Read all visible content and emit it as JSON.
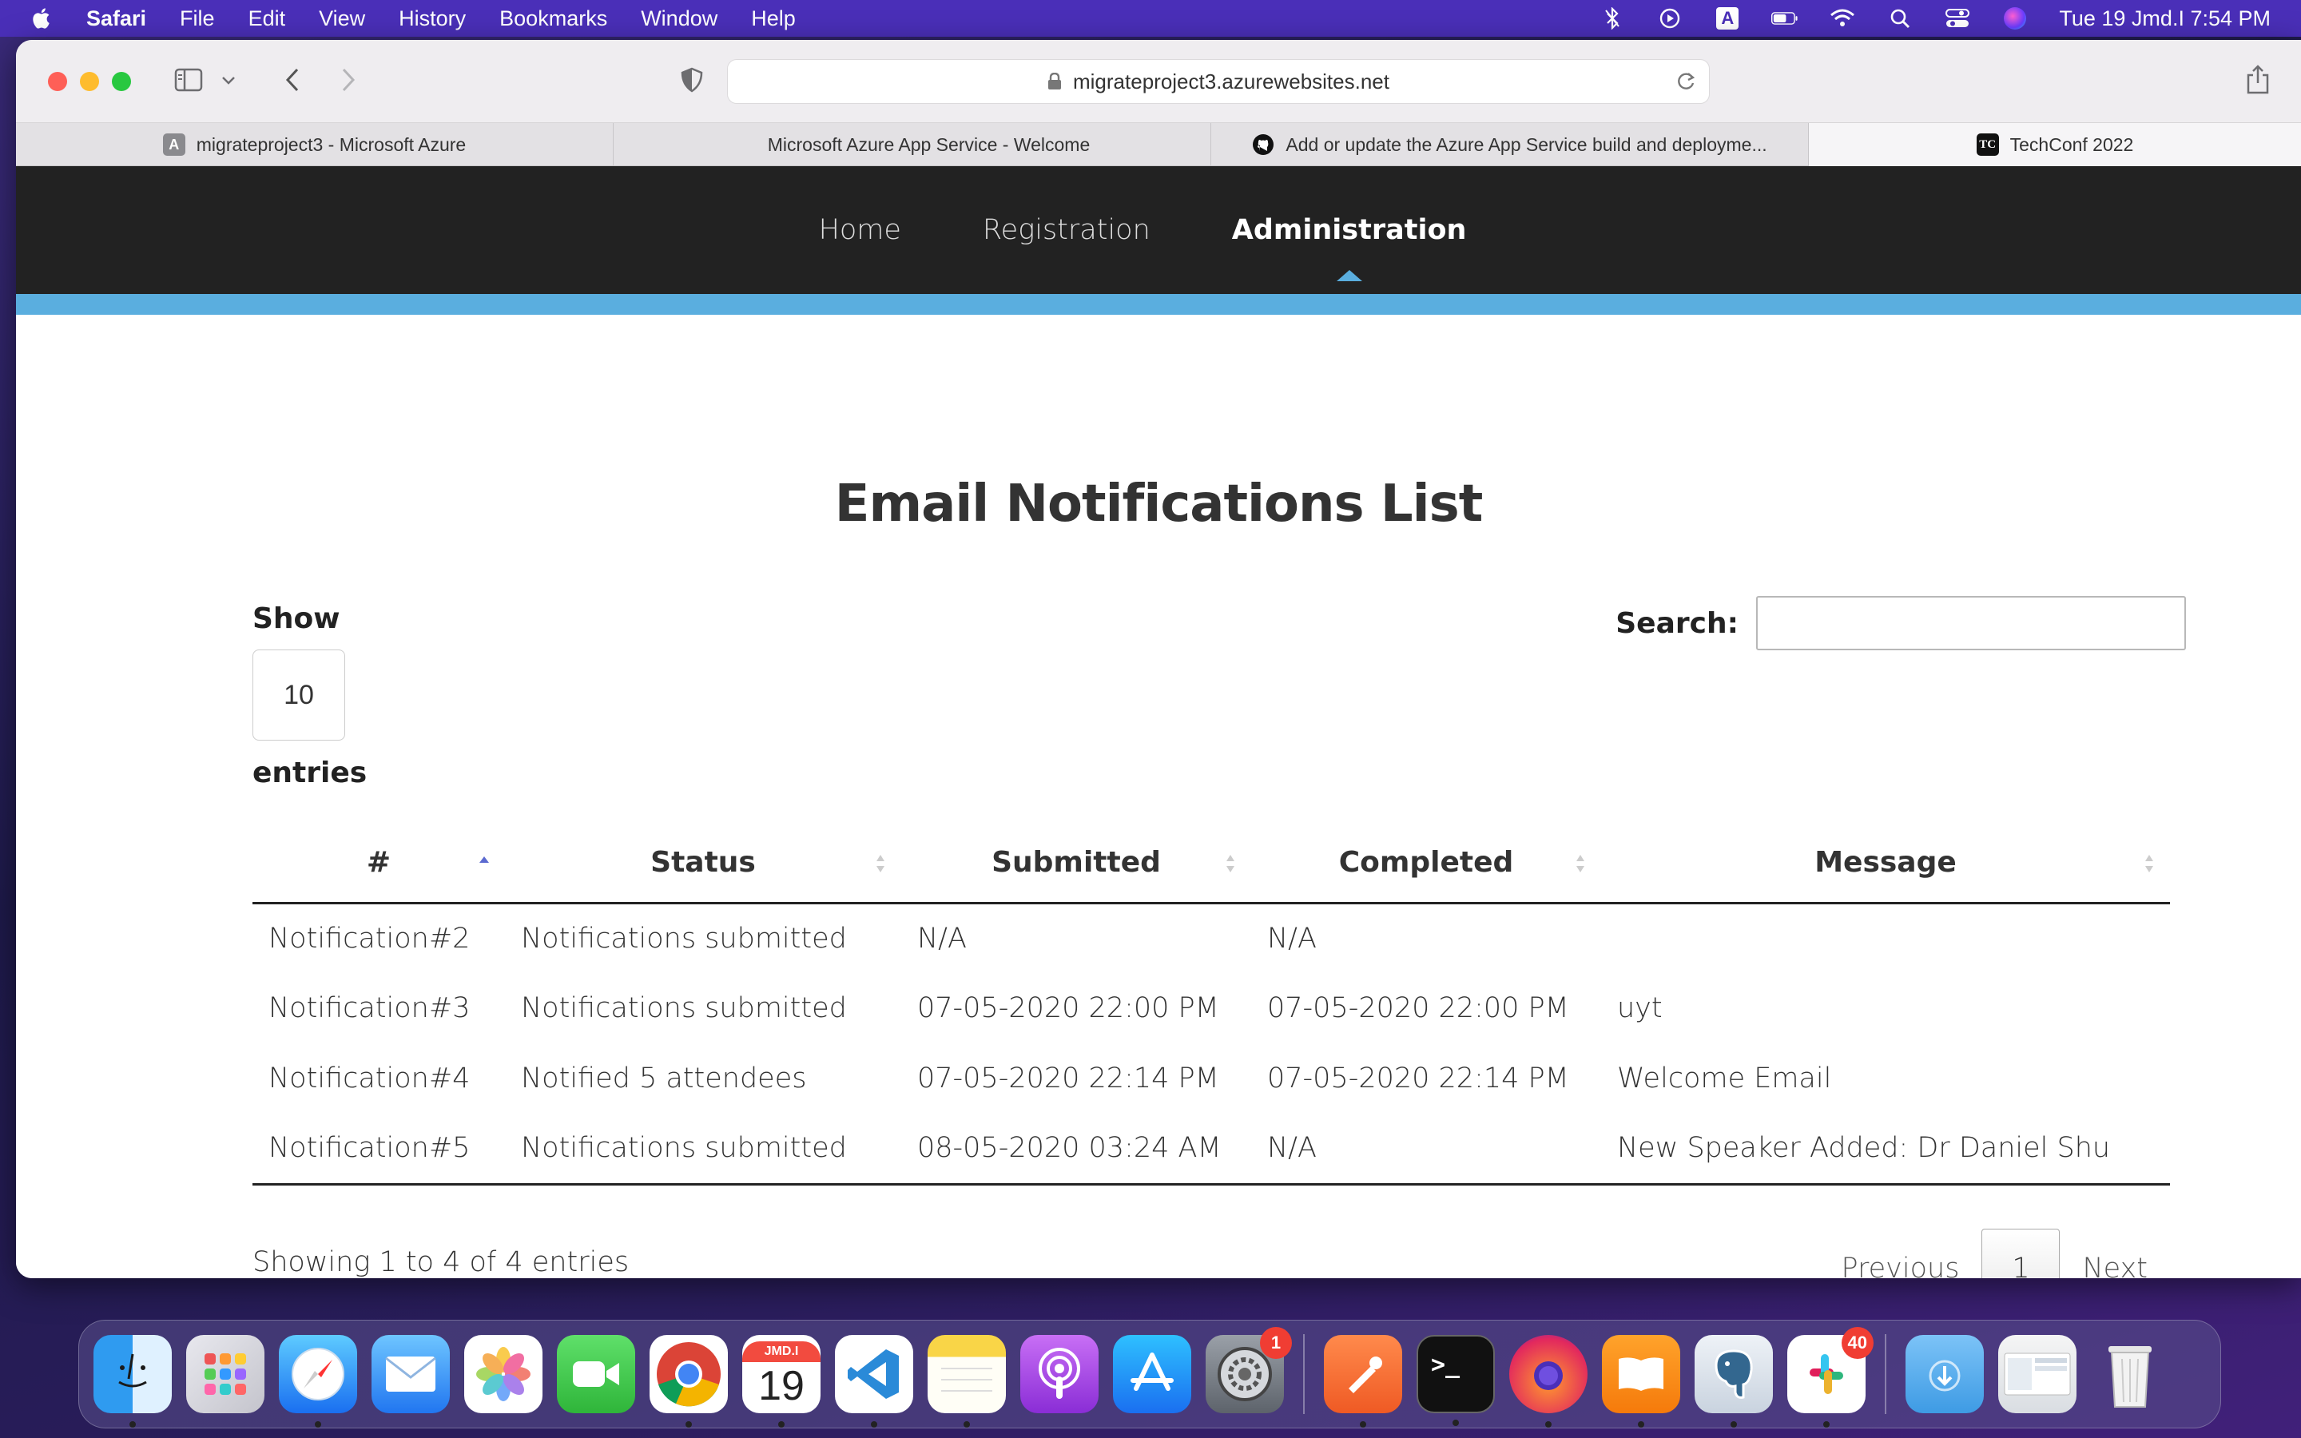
{
  "menubar": {
    "app": "Safari",
    "items": [
      "File",
      "Edit",
      "View",
      "History",
      "Bookmarks",
      "Window",
      "Help"
    ],
    "clock": "Tue 19 Jmd.I  7:54 PM",
    "input_indicator": "A"
  },
  "browser": {
    "url": "migrateproject3.azurewebsites.net",
    "tabs": [
      {
        "label": "migrateproject3 - Microsoft Azure",
        "icon_letter": "A"
      },
      {
        "label": "Microsoft Azure App Service - Welcome"
      },
      {
        "label": "Add or update the Azure App Service build and deployme..."
      },
      {
        "label": "TechConf 2022",
        "icon_letter": "TC"
      }
    ]
  },
  "nav": {
    "items": [
      {
        "label": "Home",
        "active": false
      },
      {
        "label": "Registration",
        "active": false
      },
      {
        "label": "Administration",
        "active": true
      }
    ]
  },
  "page": {
    "title": "Email Notifications List",
    "show_label": "Show",
    "length_value": "10",
    "entries_label": "entries",
    "search_label": "Search:",
    "search_value": ""
  },
  "table": {
    "columns": [
      "#",
      "Status",
      "Submitted",
      "Completed",
      "Message"
    ],
    "rows": [
      [
        "Notification#2",
        "Notifications submitted",
        "N/A",
        "N/A",
        ""
      ],
      [
        "Notification#3",
        "Notifications submitted",
        "07-05-2020 22:00 PM",
        "07-05-2020 22:00 PM",
        "uyt"
      ],
      [
        "Notification#4",
        "Notified 5 attendees",
        "07-05-2020 22:14 PM",
        "07-05-2020 22:14 PM",
        "Welcome Email"
      ],
      [
        "Notification#5",
        "Notifications submitted",
        "08-05-2020 03:24 AM",
        "N/A",
        "New Speaker Added: Dr Daniel Shu"
      ]
    ],
    "info": "Showing 1 to 4 of 4 entries",
    "pagination": {
      "previous": "Previous",
      "current": "1",
      "next": "Next"
    }
  },
  "dock": {
    "calendar_month": "JMD.I",
    "calendar_day": "19",
    "settings_badge": "1",
    "slack_badge": "40"
  },
  "colors": {
    "nav_bg": "#222222",
    "accent": "#5aaedf",
    "menubar": "#4a2fb8"
  }
}
